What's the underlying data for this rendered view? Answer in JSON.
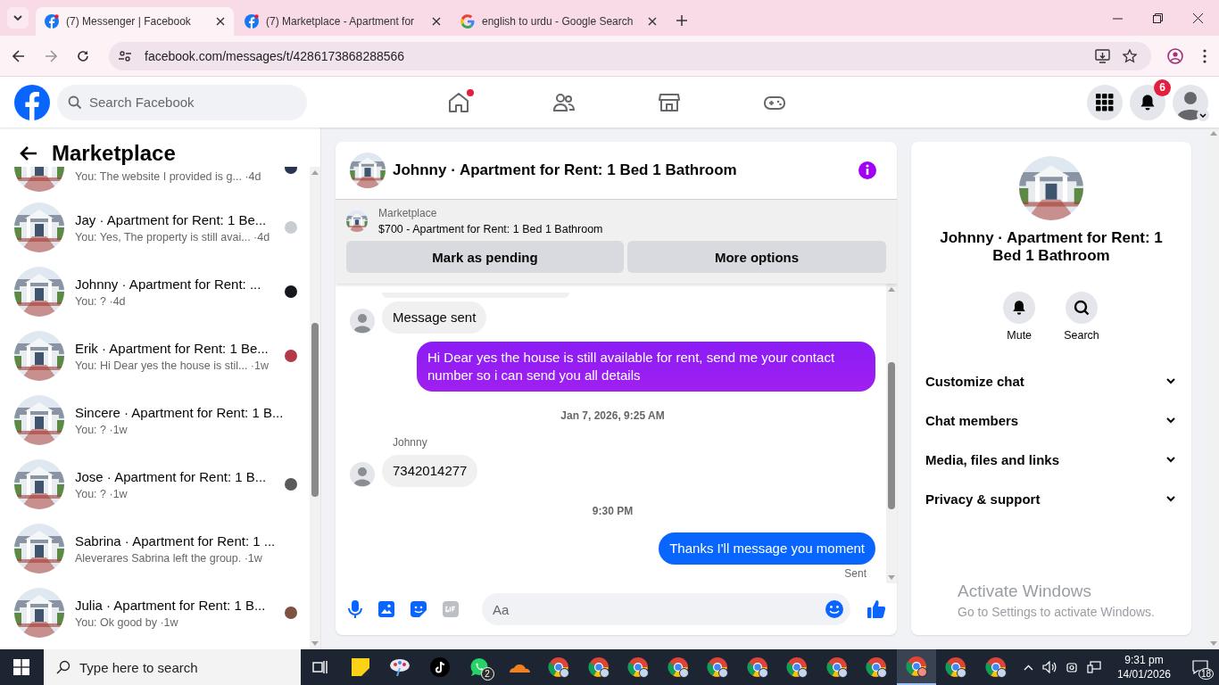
{
  "browser": {
    "tabs": [
      {
        "kind": "facebook",
        "title": "(7) Messenger | Facebook",
        "selected": true
      },
      {
        "kind": "facebook",
        "title": "(7) Marketplace - Apartment for",
        "selected": false
      },
      {
        "kind": "google",
        "title": "english to urdu - Google Search",
        "selected": false
      }
    ],
    "url": "facebook.com/messages/t/4286173868288566"
  },
  "header": {
    "search": {
      "placeholder": "Search Facebook"
    },
    "nav": [
      {
        "kind": "home",
        "dot": true
      },
      {
        "kind": "friends",
        "dot": false
      },
      {
        "kind": "marketplace",
        "dot": false
      },
      {
        "kind": "gaming",
        "dot": false
      }
    ],
    "notifications": "6"
  },
  "sidebar": {
    "title": "Marketplace",
    "conversations": [
      {
        "partial": true,
        "preview": "You: The website I provided is g...",
        "time": "·4d",
        "color": "#2b3352"
      },
      {
        "title": "Jay · Apartment for Rent: 1 Be...",
        "preview": "You: Yes, The property is still avai...",
        "time": "·4d",
        "color": "#c9ccd1"
      },
      {
        "title": "Johnny · Apartment for Rent: ...",
        "preview": "You: ?",
        "time": "·4d",
        "color": "#15171c"
      },
      {
        "title": "Erik · Apartment for Rent: 1 Be...",
        "preview": "You: Hi Dear yes the house is stil...",
        "time": "·1w",
        "color": "#b5384a"
      },
      {
        "title": "Sincere · Apartment for Rent: 1 B...",
        "preview": "You: ?",
        "time": "·1w"
      },
      {
        "title": "Jose · Apartment for Rent: 1 B...",
        "preview": "You: ?",
        "time": "·1w",
        "color": "#5a5a5a"
      },
      {
        "title": "Sabrina · Apartment for Rent: 1 ...",
        "preview": "Aleverares Sabrina left the group.",
        "time": "·1w"
      },
      {
        "title": "Julia · Apartment for Rent: 1 B...",
        "preview": "You: Ok good by",
        "time": "·1w",
        "color": "#7d5240"
      }
    ]
  },
  "chat": {
    "title": "Johnny · Apartment for Rent: 1 Bed 1 Bathroom",
    "listing": {
      "label": "Marketplace",
      "text": "$700 - Apartment for Rent: 1 Bed 1 Bathroom",
      "buttons": [
        "Mark as pending",
        "More options"
      ]
    },
    "messages": [
      {
        "kind": "incoming",
        "text": "Message sent"
      },
      {
        "kind": "outgoing",
        "text": "Hi Dear yes the house is still available for rent, send me your contact number so i can send you all details"
      },
      {
        "kind": "timestamp",
        "text": "Jan 7, 2026, 9:25 AM"
      },
      {
        "kind": "incoming",
        "sender": "Johnny",
        "text": "7342014277"
      },
      {
        "kind": "timestamp",
        "text": "9:30 PM"
      },
      {
        "kind": "outgoing",
        "text": "Thanks I'll message you moment"
      },
      {
        "kind": "status",
        "text": "Sent"
      }
    ],
    "composer": {
      "placeholder": "Aa"
    }
  },
  "details": {
    "title": "Johnny · Apartment for Rent: 1 Bed 1 Bathroom",
    "actions": [
      {
        "kind": "mute",
        "label": "Mute"
      },
      {
        "kind": "search",
        "label": "Search"
      }
    ],
    "sections": [
      "Customize chat",
      "Chat members",
      "Media, files and links",
      "Privacy & support"
    ]
  },
  "watermark": {
    "title": "Activate Windows",
    "text": "Go to Settings to activate Windows."
  },
  "taskbar": {
    "search": {
      "placeholder": "Type here to search"
    },
    "apps": [
      {
        "kind": "taskview",
        "selected": false
      },
      {
        "kind": "notes",
        "selected": false
      },
      {
        "kind": "paint",
        "selected": false
      },
      {
        "kind": "tiktok",
        "selected": false
      },
      {
        "kind": "whatsapp",
        "badge": "2",
        "selected": false
      },
      {
        "kind": "cloud",
        "selected": false
      },
      {
        "kind": "chrome",
        "selected": false
      },
      {
        "kind": "chrome",
        "selected": false
      },
      {
        "kind": "chrome",
        "selected": false
      },
      {
        "kind": "chrome",
        "selected": false
      },
      {
        "kind": "chrome",
        "selected": false
      },
      {
        "kind": "chrome",
        "selected": false
      },
      {
        "kind": "chrome",
        "selected": false
      },
      {
        "kind": "chrome",
        "selected": false
      },
      {
        "kind": "chrome",
        "selected": false
      },
      {
        "kind": "chrome",
        "selected": true
      },
      {
        "kind": "chrome",
        "selected": false
      },
      {
        "kind": "chrome",
        "selected": false
      }
    ],
    "time": "9:31 pm",
    "date": "14/01/2026",
    "notifications": "18"
  }
}
